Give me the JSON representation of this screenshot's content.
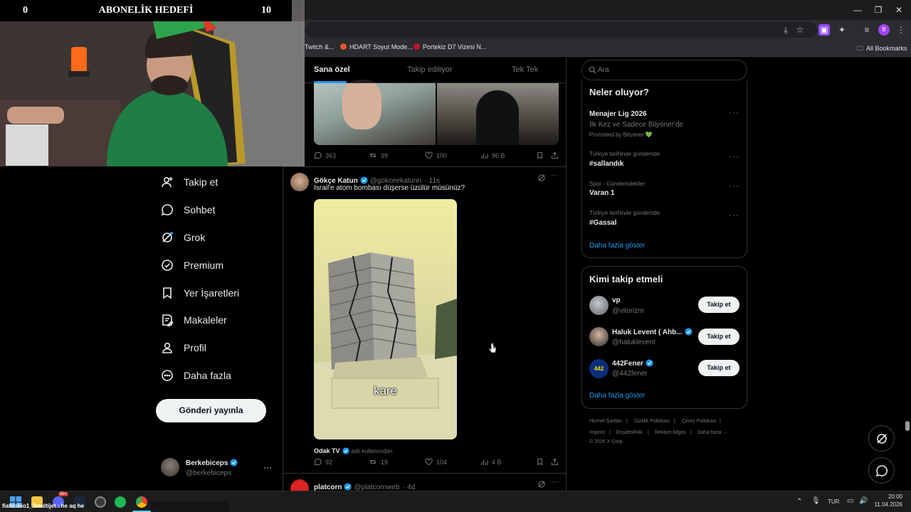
{
  "overlay": {
    "left_count": "0",
    "title": "ABONELİK HEDEFİ",
    "right_count": "10"
  },
  "browser": {
    "bookmarks": [
      {
        "label": "Twitch &..."
      },
      {
        "label": "HDART Soyut Mode..."
      },
      {
        "label": "Portekiz D7 Vizesi N..."
      }
    ],
    "all_bookmarks": "All Bookmarks",
    "profile_initial": "B",
    "window_controls": {
      "minimize": "—",
      "restore": "❐",
      "close": "✕"
    }
  },
  "nav": {
    "items": [
      {
        "label": "Takip et",
        "icon": "add-person-icon"
      },
      {
        "label": "Sohbet",
        "icon": "chat-icon"
      },
      {
        "label": "Grok",
        "icon": "grok-icon"
      },
      {
        "label": "Premium",
        "icon": "premium-icon"
      },
      {
        "label": "Yer İşaretleri",
        "icon": "bookmark-icon"
      },
      {
        "label": "Makaleler",
        "icon": "articles-icon"
      },
      {
        "label": "Profil",
        "icon": "profile-icon"
      },
      {
        "label": "Daha fazla",
        "icon": "more-circle-icon"
      }
    ],
    "post_button": "Gönderi yayınla",
    "account": {
      "name": "Berkebiceps",
      "handle": "@berkebiceps",
      "more": "···"
    }
  },
  "feed": {
    "tabs": [
      {
        "label": "Sana özel",
        "active": true
      },
      {
        "label": "Takip ediliyor",
        "active": false
      },
      {
        "label": "Tek Tek",
        "active": false
      }
    ],
    "prev_tweet_actions": {
      "replies": "363",
      "reposts": "99",
      "likes": "100",
      "views": "96 B"
    },
    "tweet": {
      "name": "Gökçe Katun",
      "handle": "@gokceekatunn",
      "time": "· 11s",
      "text": "İsrail'e atom bombası düşerse üzülür müsünüz?",
      "media_caption": "kare",
      "source_name": "Odak TV",
      "source_note": "adlı kullanıcıdan",
      "actions": {
        "replies": "92",
        "reposts": "19",
        "likes": "104",
        "views": "4 B"
      },
      "more": "···"
    },
    "next_tweet": {
      "name": "platcorn",
      "handle": "@platcornweb",
      "time": "· 4d",
      "more": "···"
    }
  },
  "sidebar": {
    "search_placeholder": "Ara",
    "trends_title": "Neler oluyor?",
    "trends": [
      {
        "meta": "",
        "name": "Menajer Lig 2026",
        "sub": "İlk Kez ve Sadece Bilyoner'de",
        "promoted": "Promoted by Bilyoner 💚"
      },
      {
        "meta": "Türkiye tarihinde gündemde",
        "name": "#sallandık"
      },
      {
        "meta": "Spor · Gündemdekiler",
        "name": "Varan 1"
      },
      {
        "meta": "Türkiye tarihinde gündemde",
        "name": "#Gassal"
      }
    ],
    "trends_more": "Daha fazla göster",
    "who_title": "Kimi takip etmeli",
    "suggestions": [
      {
        "name": "vp",
        "handle": "@vitorizm",
        "button": "Takip et",
        "verified": false
      },
      {
        "name": "Haluk Levent ( Ahb...",
        "handle": "@haluklevent",
        "button": "Takip et",
        "verified": true
      },
      {
        "name": "442Fener",
        "handle": "@442fener",
        "button": "Takip et",
        "verified": true
      }
    ],
    "who_more": "Daha fazla göster",
    "footer": [
      "Hizmet Şartları",
      "|",
      "Gizlilik Politikası",
      "|",
      "Çerez Politikası",
      "|",
      "Imprint",
      "|",
      "Erişilebilirlik",
      "|",
      "Reklam bilgisi",
      "|",
      "Daha fazla ···",
      "© 2026 X Corp."
    ]
  },
  "taskbar": {
    "chat_text": "fiafdobio1_3multijet : he aq he",
    "language": "TUR",
    "time": "20:00",
    "date": "11.04.2026",
    "notif_badge": "99+"
  },
  "colors": {
    "accent": "#1d9bf0",
    "background": "#000000",
    "border": "#2f3336",
    "muted": "#71767b",
    "text": "#e7e9ea"
  }
}
